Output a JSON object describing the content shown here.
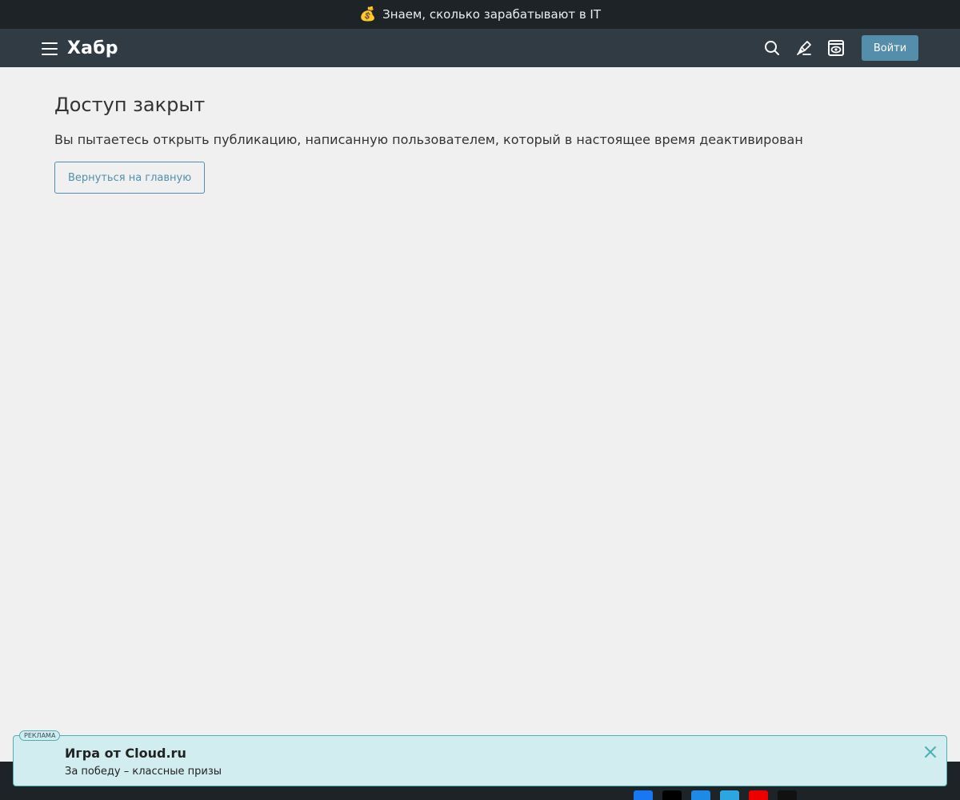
{
  "promo": {
    "icon": "money-bag-icon",
    "text": "Знаем, сколько зарабатывают в IT"
  },
  "header": {
    "logo": "Хабр",
    "icons": [
      "menu-icon",
      "search-icon",
      "write-icon",
      "reading-mode-icon"
    ],
    "login_label": "Войти"
  },
  "main": {
    "title": "Доступ закрыт",
    "message": "Вы пытаетесь открыть публикацию, написанную пользователем, который в настоящее время деактивирован",
    "back_label": "Вернуться на главную"
  },
  "ad": {
    "tag": "РЕКЛАМА",
    "title": "Игра от Cloud.ru",
    "text": "За победу – классные призы"
  },
  "colors": {
    "promo_bg": "#1e2327",
    "header_bg": "#303b44",
    "page_bg": "#f0f0f0",
    "accent": "#548eaa",
    "ad_bg": "#d1edf0",
    "ad_border": "#4eafb3"
  }
}
